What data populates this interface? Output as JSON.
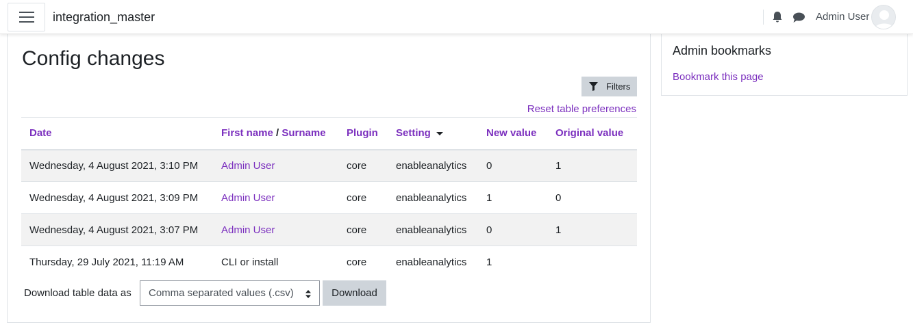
{
  "header": {
    "site_name": "integration_master",
    "user_name": "Admin User",
    "icons": [
      "menu-icon",
      "bell-icon",
      "chat-icon",
      "user-avatar"
    ]
  },
  "main": {
    "title": "Config changes",
    "filters_label": "Filters",
    "reset_label": "Reset table preferences",
    "table": {
      "headers": {
        "date": "Date",
        "first_name": "First name",
        "separator": "/",
        "surname": "Surname",
        "plugin": "Plugin",
        "setting": "Setting",
        "new_value": "New value",
        "original_value": "Original value"
      },
      "rows": [
        {
          "date": "Wednesday, 4 August 2021, 3:10 PM",
          "user": "Admin User",
          "plugin": "core",
          "setting": "enableanalytics",
          "new_value": "0",
          "original_value": "1"
        },
        {
          "date": "Wednesday, 4 August 2021, 3:09 PM",
          "user": "Admin User",
          "plugin": "core",
          "setting": "enableanalytics",
          "new_value": "1",
          "original_value": "0"
        },
        {
          "date": "Wednesday, 4 August 2021, 3:07 PM",
          "user": "Admin User",
          "plugin": "core",
          "setting": "enableanalytics",
          "new_value": "0",
          "original_value": "1"
        },
        {
          "date": "Thursday, 29 July 2021, 11:19 AM",
          "user": "CLI or install",
          "plugin": "core",
          "setting": "enableanalytics",
          "new_value": "1",
          "original_value": ""
        }
      ]
    },
    "download": {
      "label": "Download table data as",
      "selected_format": "Comma separated values (.csv)",
      "button_label": "Download"
    }
  },
  "sidebar": {
    "bookmarks_title": "Admin bookmarks",
    "bookmark_link": "Bookmark this page"
  },
  "colors": {
    "link": "#7b2fbe",
    "button_bg": "#ced4da",
    "striped_row": "#f2f2f2"
  }
}
